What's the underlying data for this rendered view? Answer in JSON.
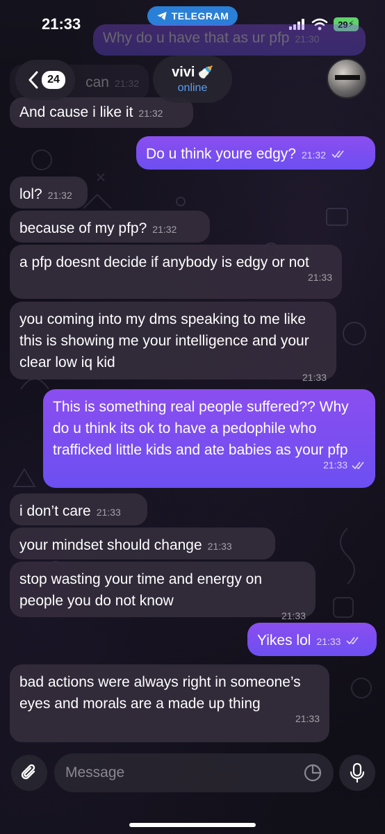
{
  "status_bar": {
    "time": "21:33",
    "app_pill": "TELEGRAM",
    "battery": "29"
  },
  "header": {
    "back_count": "24",
    "contact_name": "vivi",
    "contact_emoji": "🍼",
    "contact_status": "online"
  },
  "messages": [
    {
      "dir": "out",
      "text": "Why do u have that as ur pfp",
      "time": "21:30",
      "faded": true
    },
    {
      "dir": "in",
      "text": "can",
      "time": "21:32",
      "faded": true
    },
    {
      "dir": "in",
      "text": "And cause i like it",
      "time": "21:32"
    },
    {
      "dir": "out",
      "text": "Do u think youre edgy?",
      "time": "21:32"
    },
    {
      "dir": "in",
      "text": "lol?",
      "time": "21:32"
    },
    {
      "dir": "in",
      "text": "because of my pfp?",
      "time": "21:32"
    },
    {
      "dir": "in",
      "text": "a pfp doesnt decide if anybody is edgy or not",
      "time": "21:33"
    },
    {
      "dir": "in",
      "text": "you coming into my dms speaking to me like this is showing me your intelligence and your clear low iq kid",
      "time": "21:33"
    },
    {
      "dir": "out",
      "text": "This is something real people suffered?? Why do u think its ok to have a pedophile who trafficked little kids and ate babies as your pfp",
      "time": "21:33"
    },
    {
      "dir": "in",
      "text": "i don’t care",
      "time": "21:33"
    },
    {
      "dir": "in",
      "text": "your mindset should change",
      "time": "21:33"
    },
    {
      "dir": "in",
      "text": "stop wasting your time and energy on people you do not know",
      "time": "21:33"
    },
    {
      "dir": "out",
      "text": "Yikes lol",
      "time": "21:33"
    },
    {
      "dir": "in",
      "text": "bad actions were always right in someone’s eyes and morals are a made up thing",
      "time": "21:33"
    }
  ],
  "input": {
    "placeholder": "Message"
  },
  "icons": {
    "back": "chevron-left-icon",
    "telegram": "telegram-plane-icon",
    "attach": "paperclip-icon",
    "sticker": "sticker-icon",
    "mic": "microphone-icon",
    "read": "double-check-icon"
  },
  "colors": {
    "outgoing_bubble": "#7a4ff1",
    "incoming_bubble": "#342c3c",
    "online": "#5a9ef0",
    "telegram_pill": "#2a7fd6",
    "battery": "#5fd36a"
  }
}
